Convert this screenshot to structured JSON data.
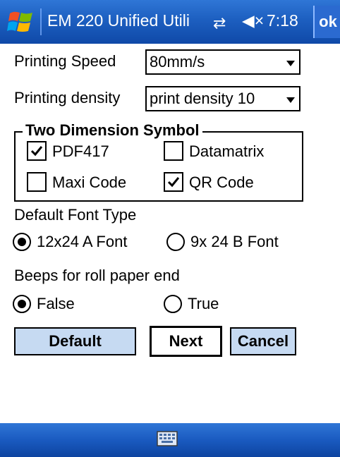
{
  "titlebar": {
    "app_title": "EM 220 Unified Utili",
    "connectivity_icon": "connectivity-icon",
    "volume_icon": "volume-muted-icon",
    "clock": "7:18",
    "ok_label": "ok"
  },
  "printing_speed": {
    "label": "Printing Speed",
    "value": "80mm/s"
  },
  "printing_density": {
    "label": "Printing density",
    "value": "print density 10"
  },
  "symbols": {
    "title": "Two Dimension Symbol",
    "pdf417": {
      "label": "PDF417",
      "checked": true
    },
    "datamatrix": {
      "label": "Datamatrix",
      "checked": false
    },
    "maxicode": {
      "label": "Maxi Code",
      "checked": false
    },
    "qrcode": {
      "label": "QR Code",
      "checked": true
    }
  },
  "font_type": {
    "label": "Default Font Type",
    "option_a": "12x24 A Font",
    "option_b": "9x 24 B Font",
    "selected": "option_a"
  },
  "beeps": {
    "label": "Beeps for roll paper end",
    "option_false": "False",
    "option_true": "True",
    "selected": "option_false"
  },
  "buttons": {
    "default": "Default",
    "next": "Next",
    "cancel": "Cancel"
  },
  "bottombar": {
    "keyboard_icon": "keyboard-icon"
  }
}
